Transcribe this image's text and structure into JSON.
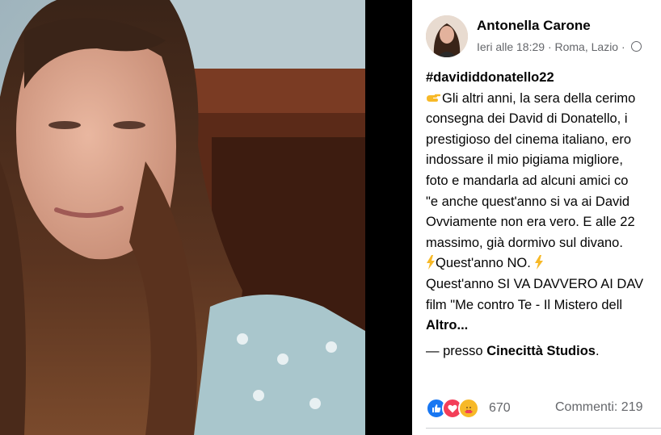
{
  "post": {
    "author": "Antonella Carone",
    "meta": "Ieri alle 18:29 · Roma, Lazio ·",
    "hashtag": "#davididdonatello22",
    "lines": [
      "Gli altri anni, la sera della cerimo",
      "consegna dei David di Donatello, i",
      "prestigioso del cinema italiano, ero",
      "indossare il mio pigiama migliore,",
      "foto e mandarla ad alcuni amici co",
      "\"e anche quest'anno si va ai David",
      "Ovviamente non era vero. E alle 22",
      "massimo, già dormivo sul divano.",
      "Quest'anno NO.",
      "Quest'anno SI VA DAVVERO AI DAV",
      "film \"Me contro Te - Il Mistero dell"
    ],
    "more_label": "Altro...",
    "place_prefix": "— presso ",
    "place_name": "Cinecittà Studios",
    "place_suffix": ".",
    "reaction_count": "670",
    "comments": "Commenti: 219",
    "icons": [
      "pointing-finger-icon",
      "lightning-icon",
      "globe-icon",
      "like-icon",
      "love-icon",
      "care-icon"
    ]
  }
}
